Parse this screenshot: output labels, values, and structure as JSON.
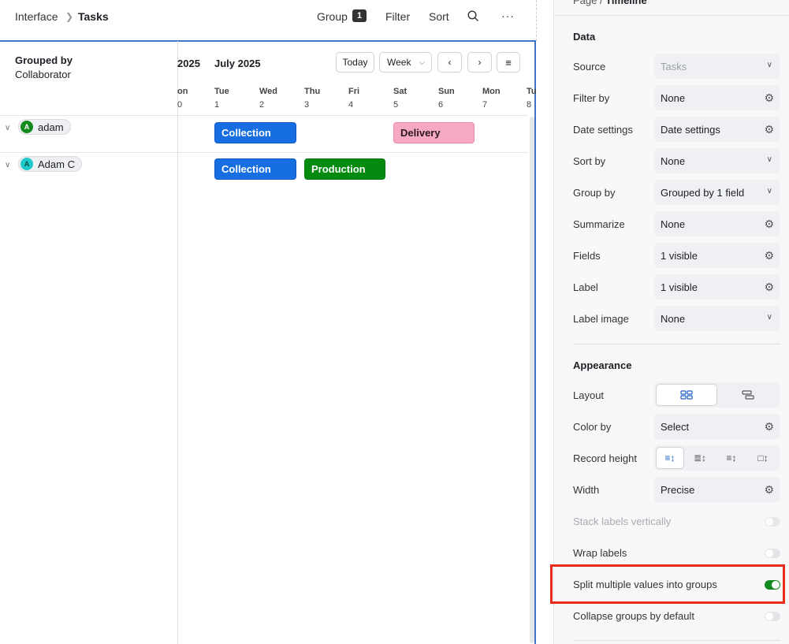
{
  "breadcrumb": {
    "root": "Interface",
    "current": "Tasks"
  },
  "toolbar": {
    "group": "Group",
    "group_count": "1",
    "filter": "Filter",
    "sort": "Sort"
  },
  "group_panel": {
    "title": "Grouped by",
    "subtitle": "Collaborator"
  },
  "timeline": {
    "prev_month": "2025",
    "month": "July 2025",
    "today": "Today",
    "range": "Week",
    "days": [
      {
        "name": "on",
        "num": "0"
      },
      {
        "name": "Tue",
        "num": "1"
      },
      {
        "name": "Wed",
        "num": "2"
      },
      {
        "name": "Thu",
        "num": "3"
      },
      {
        "name": "Fri",
        "num": "4"
      },
      {
        "name": "Sat",
        "num": "5"
      },
      {
        "name": "Sun",
        "num": "6"
      },
      {
        "name": "Mon",
        "num": "7"
      },
      {
        "name": "Tu",
        "num": "8"
      }
    ],
    "groups": [
      {
        "initial": "A",
        "name": "adam",
        "color": "#138a1d"
      },
      {
        "initial": "A",
        "name": "Adam C",
        "color": "#20c9c9"
      }
    ],
    "events": [
      {
        "label": "Collection",
        "color": "blue"
      },
      {
        "label": "Delivery",
        "color": "pink"
      },
      {
        "label": "Collection",
        "color": "blue"
      },
      {
        "label": "Production",
        "color": "green"
      }
    ]
  },
  "panel": {
    "crumb_prefix": "Page / ",
    "crumb_title": "Timeline",
    "data_title": "Data",
    "rows": [
      {
        "label": "Source",
        "value": "Tasks"
      },
      {
        "label": "Filter by",
        "value": "None"
      },
      {
        "label": "Date settings",
        "value": "Date settings"
      },
      {
        "label": "Sort by",
        "value": "None"
      },
      {
        "label": "Group by",
        "value": "Grouped by 1 field"
      },
      {
        "label": "Summarize",
        "value": "None"
      },
      {
        "label": "Fields",
        "value": "1 visible"
      },
      {
        "label": "Label",
        "value": "1 visible"
      },
      {
        "label": "Label image",
        "value": "None"
      }
    ],
    "appearance_title": "Appearance",
    "layout_label": "Layout",
    "color_by_label": "Color by",
    "color_by_value": "Select",
    "record_height_label": "Record height",
    "width_label": "Width",
    "width_value": "Precise",
    "toggles": [
      {
        "label": "Stack labels vertically",
        "on": false,
        "disabled": true
      },
      {
        "label": "Wrap labels",
        "on": false
      },
      {
        "label": "Split multiple values into groups",
        "on": true
      },
      {
        "label": "Collapse groups by default",
        "on": false
      }
    ]
  },
  "colors": {
    "accent": "#166ee1",
    "toggle_on": "#138a1d",
    "highlight": "#ea2b1e"
  }
}
